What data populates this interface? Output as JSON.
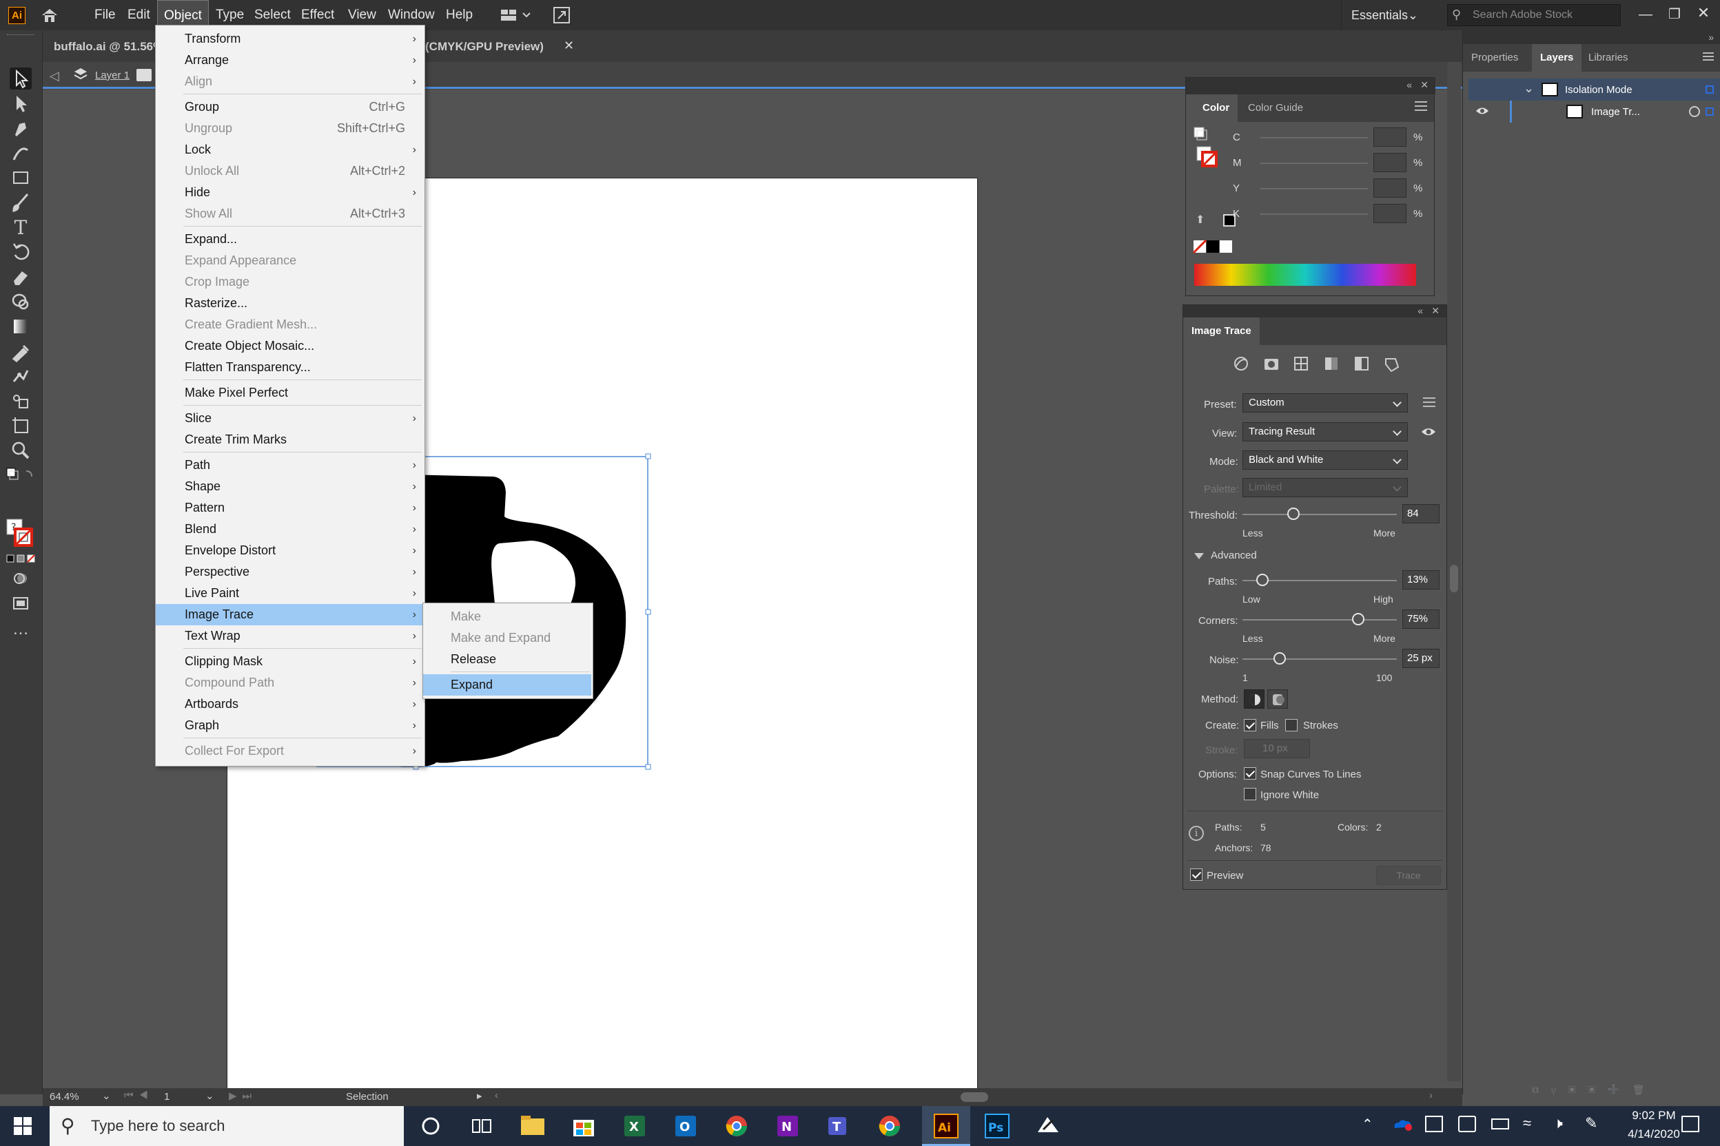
{
  "menubar": {
    "app_logo": "Ai",
    "items": [
      "File",
      "Edit",
      "Object",
      "Type",
      "Select",
      "Effect",
      "View",
      "Window",
      "Help"
    ],
    "active_item": "Object",
    "workspace": "Essentials",
    "search_placeholder": "Search Adobe Stock"
  },
  "document": {
    "tab1": "buffalo.ai @ 51.56%",
    "tab2": "(CMYK/GPU Preview)",
    "layer_label": "Layer 1"
  },
  "object_menu": [
    {
      "label": "Transform",
      "arrow": true
    },
    {
      "label": "Arrange",
      "arrow": true
    },
    {
      "label": "Align",
      "arrow": true,
      "disabled": true
    },
    {
      "sep": true
    },
    {
      "label": "Group",
      "shortcut": "Ctrl+G"
    },
    {
      "label": "Ungroup",
      "shortcut": "Shift+Ctrl+G",
      "disabled": true
    },
    {
      "label": "Lock",
      "arrow": true
    },
    {
      "label": "Unlock All",
      "shortcut": "Alt+Ctrl+2",
      "disabled": true
    },
    {
      "label": "Hide",
      "arrow": true
    },
    {
      "label": "Show All",
      "shortcut": "Alt+Ctrl+3",
      "disabled": true
    },
    {
      "sep": true
    },
    {
      "label": "Expand..."
    },
    {
      "label": "Expand Appearance",
      "disabled": true
    },
    {
      "label": "Crop Image",
      "disabled": true
    },
    {
      "label": "Rasterize..."
    },
    {
      "label": "Create Gradient Mesh...",
      "disabled": true
    },
    {
      "label": "Create Object Mosaic..."
    },
    {
      "label": "Flatten Transparency..."
    },
    {
      "sep": true
    },
    {
      "label": "Make Pixel Perfect"
    },
    {
      "sep": true
    },
    {
      "label": "Slice",
      "arrow": true
    },
    {
      "label": "Create Trim Marks"
    },
    {
      "sep": true
    },
    {
      "label": "Path",
      "arrow": true
    },
    {
      "label": "Shape",
      "arrow": true
    },
    {
      "label": "Pattern",
      "arrow": true
    },
    {
      "label": "Blend",
      "arrow": true
    },
    {
      "label": "Envelope Distort",
      "arrow": true
    },
    {
      "label": "Perspective",
      "arrow": true
    },
    {
      "label": "Live Paint",
      "arrow": true
    },
    {
      "label": "Image Trace",
      "arrow": true,
      "selected": true
    },
    {
      "label": "Text Wrap",
      "arrow": true
    },
    {
      "sep": true
    },
    {
      "label": "Clipping Mask",
      "arrow": true
    },
    {
      "label": "Compound Path",
      "arrow": true,
      "disabled": true
    },
    {
      "label": "Artboards",
      "arrow": true
    },
    {
      "label": "Graph",
      "arrow": true
    },
    {
      "sep": true
    },
    {
      "label": "Collect For Export",
      "arrow": true,
      "disabled": true
    }
  ],
  "image_trace_submenu": [
    {
      "label": "Make",
      "disabled": true
    },
    {
      "label": "Make and Expand",
      "disabled": true
    },
    {
      "label": "Release"
    },
    {
      "sep": true
    },
    {
      "label": "Expand",
      "selected": true
    }
  ],
  "color_panel": {
    "tab_active": "Color",
    "tab_other": "Color Guide",
    "channels": [
      "C",
      "M",
      "Y",
      "K"
    ],
    "unit": "%"
  },
  "image_trace_panel": {
    "title": "Image Trace",
    "preset_label": "Preset:",
    "preset_value": "Custom",
    "view_label": "View:",
    "view_value": "Tracing Result",
    "mode_label": "Mode:",
    "mode_value": "Black and White",
    "palette_label": "Palette:",
    "palette_value": "Limited",
    "threshold_label": "Threshold:",
    "threshold_value": "84",
    "threshold_fraction": 0.33,
    "less": "Less",
    "more": "More",
    "advanced": "Advanced",
    "paths_label": "Paths:",
    "paths_value": "13%",
    "paths_fraction": 0.13,
    "low": "Low",
    "high": "High",
    "corners_label": "Corners:",
    "corners_value": "75%",
    "corners_fraction": 0.75,
    "noise_label": "Noise:",
    "noise_value": "25 px",
    "noise_fraction": 0.24,
    "noise_min": "1",
    "noise_max": "100",
    "method_label": "Method:",
    "create_label": "Create:",
    "fills": "Fills",
    "fills_checked": true,
    "strokes": "Strokes",
    "strokes_checked": false,
    "stroke_label": "Stroke:",
    "stroke_value": "10 px",
    "options_label": "Options:",
    "snap": "Snap Curves To Lines",
    "snap_checked": true,
    "ignore_white": "Ignore White",
    "ignore_white_checked": false,
    "stats_paths_label": "Paths:",
    "stats_paths": "5",
    "stats_colors_label": "Colors:",
    "stats_colors": "2",
    "stats_anchors_label": "Anchors:",
    "stats_anchors": "78",
    "preview": "Preview",
    "preview_checked": true,
    "trace_button": "Trace"
  },
  "layers_panel": {
    "tabs": [
      "Properties",
      "Layers",
      "Libraries"
    ],
    "active_tab": "Layers",
    "rows": [
      "Isolation Mode",
      "Image Tr..."
    ]
  },
  "statusbar": {
    "zoom": "64.4%",
    "artboard_num": "1",
    "tool": "Selection"
  },
  "taskbar": {
    "search_placeholder": "Type here to search",
    "time": "9:02 PM",
    "date": "4/14/2020"
  }
}
